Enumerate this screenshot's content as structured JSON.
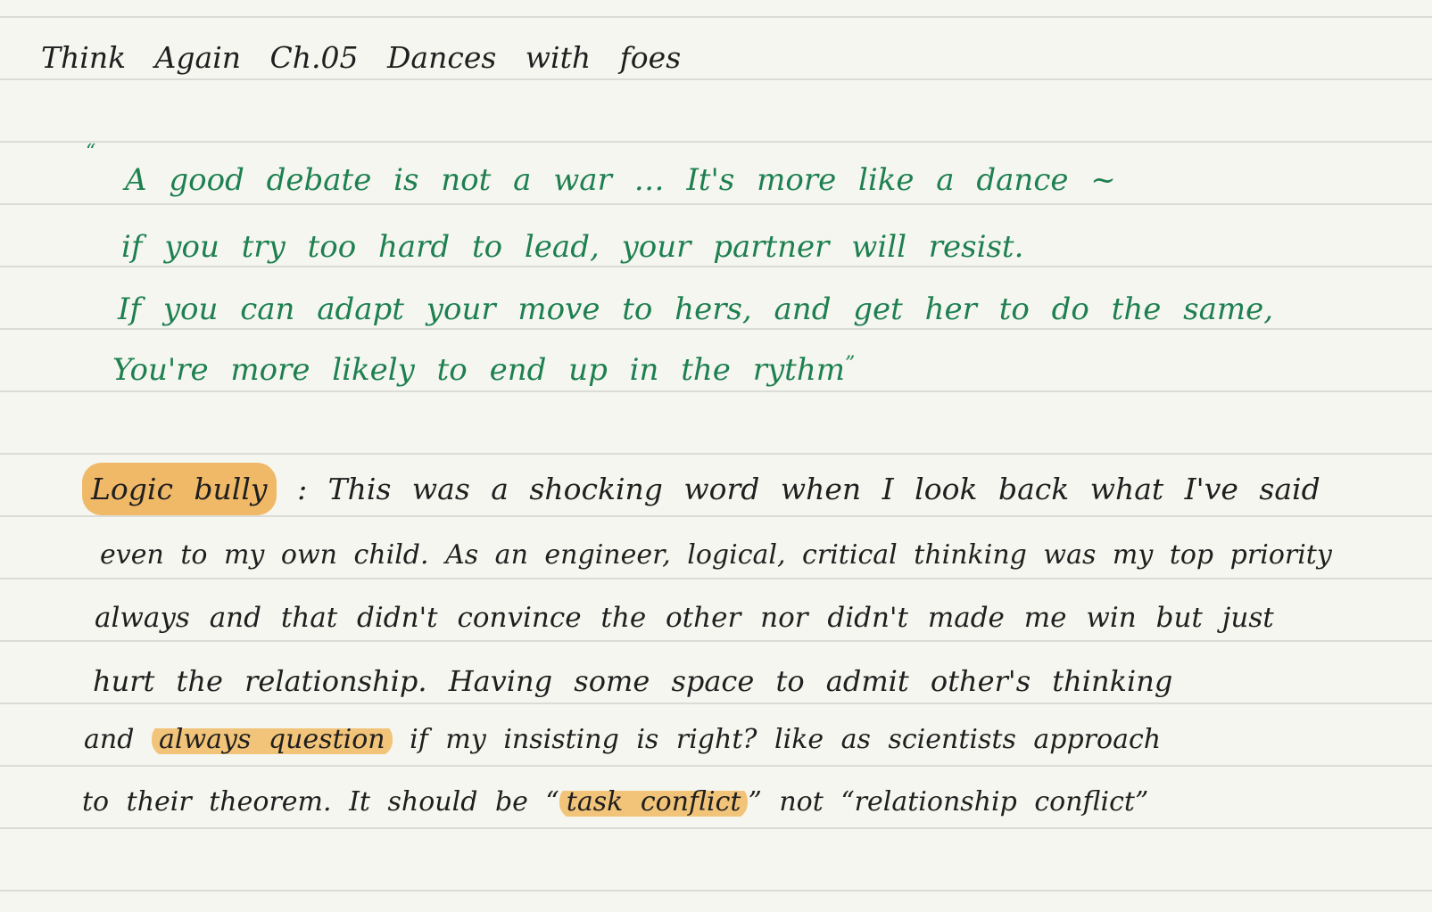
{
  "title": "Think Again Ch.05 Dances with foes",
  "quote": {
    "open_mark": "“",
    "lines": [
      "A good debate is not a war … It's more like a dance ~",
      "if you try too hard to lead, your partner will resist.",
      "If you can adapt your move to hers, and get her to do the same,",
      "You're more likely to end up in the rythm"
    ],
    "close_mark": "”"
  },
  "notes": {
    "line1": {
      "highlight": "Logic bully",
      "rest": ": This was a shocking word when I look back what I've said"
    },
    "line2": "even to my own child. As an engineer, logical, critical thinking was my top priority",
    "line3": "always and that didn't convince the other nor didn't made me win but just",
    "line4": "hurt the relationship. Having some space to admit other's thinking",
    "line5": {
      "pre": "and",
      "highlight": "always question",
      "post": "if my insisting is right? like as scientists approach"
    },
    "line6": {
      "pre": "to their theorem. It should be “",
      "highlight": "task conflict",
      "post": "” not “relationship conflict”"
    }
  },
  "colors": {
    "background": "#f6f6f0",
    "rule": "#dcdcd6",
    "quote_ink": "#1e8050",
    "note_ink": "#1f1f1f",
    "highlighter": "#f2c47a"
  }
}
